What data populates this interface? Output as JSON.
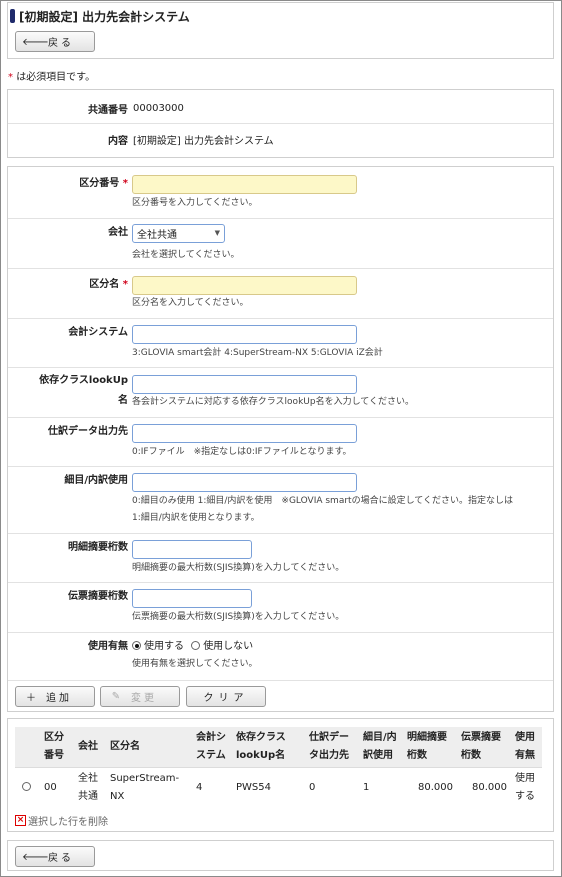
{
  "header": {
    "title": "[初期設定] 出力先会計システム",
    "back_label": "戻る"
  },
  "required_note": "は必須項目です。",
  "required_mark": "*",
  "info": [
    {
      "label": "共通番号",
      "value": "00003000"
    },
    {
      "label": "内容",
      "value": "[初期設定] 出力先会計システム"
    }
  ],
  "form": {
    "kubun_no": {
      "label": "区分番号",
      "hint": "区分番号を入力してください。",
      "value": ""
    },
    "company": {
      "label": "会社",
      "selected": "全社共通",
      "hint": "会社を選択してください。"
    },
    "kubun_name": {
      "label": "区分名",
      "hint": "区分名を入力してください。",
      "value": ""
    },
    "accounting": {
      "label": "会計システム",
      "hint": "3:GLOVIA smart会計 4:SuperStream-NX 5:GLOVIA iZ会計",
      "value": ""
    },
    "lookup": {
      "label_1": "依存クラスlookUp",
      "label_2": "名",
      "hint": "各会計システムに対応する依存クラスlookUp名を入力してください。",
      "value": ""
    },
    "journal": {
      "label": "仕訳データ出力先",
      "hint": "0:IFファイル　※指定なしは0:IFファイルとなります。",
      "value": ""
    },
    "detail": {
      "label": "細目/内訳使用",
      "hint_1": "0:細目のみ使用 1:細目/内訳を使用　※GLOVIA smartの場合に設定してください。指定なしは",
      "hint_2": "1:細目/内訳を使用となります。",
      "value": ""
    },
    "meisai_digits": {
      "label": "明細摘要桁数",
      "hint": "明細摘要の最大桁数(SJIS換算)を入力してください。",
      "value": ""
    },
    "denpyo_digits": {
      "label": "伝票摘要桁数",
      "hint": "伝票摘要の最大桁数(SJIS換算)を入力してください。",
      "value": ""
    },
    "usage": {
      "label": "使用有無",
      "option_on": "使用する",
      "option_off": "使用しない",
      "hint": "使用有無を選択してください。"
    }
  },
  "actions": {
    "add": "追加",
    "change": "変更",
    "clear": "クリア"
  },
  "table": {
    "headers": [
      [
        "区分",
        "番号"
      ],
      [
        "会社"
      ],
      [
        "区分名"
      ],
      [
        "会計シ",
        "ステム"
      ],
      [
        "依存クラス",
        "lookUp名"
      ],
      [
        "仕訳デー",
        "タ出力先"
      ],
      [
        "細目/内",
        "訳使用"
      ],
      [
        "明細摘要",
        "桁数"
      ],
      [
        "伝票摘要",
        "桁数"
      ],
      [
        "使用",
        "有無"
      ]
    ],
    "rows": [
      {
        "no": "00",
        "company": [
          "全社",
          "共通"
        ],
        "name": [
          "SuperStream-",
          "NX"
        ],
        "system": "4",
        "lookup": "PWS54",
        "journal": "0",
        "detail": "1",
        "meisai": "80.000",
        "denpyo": "80.000",
        "usage": [
          "使用",
          "する"
        ]
      }
    ],
    "delete_label": "選択した行を削除"
  },
  "icons": {
    "back": "arrow-left-icon",
    "add": "plus-icon",
    "change": "pencil-icon",
    "delete": "x-box-icon"
  },
  "colors": {
    "required_bg": "#fdf8c8",
    "title_bar": "#1f2a6b",
    "required_mark": "#d0021b"
  }
}
